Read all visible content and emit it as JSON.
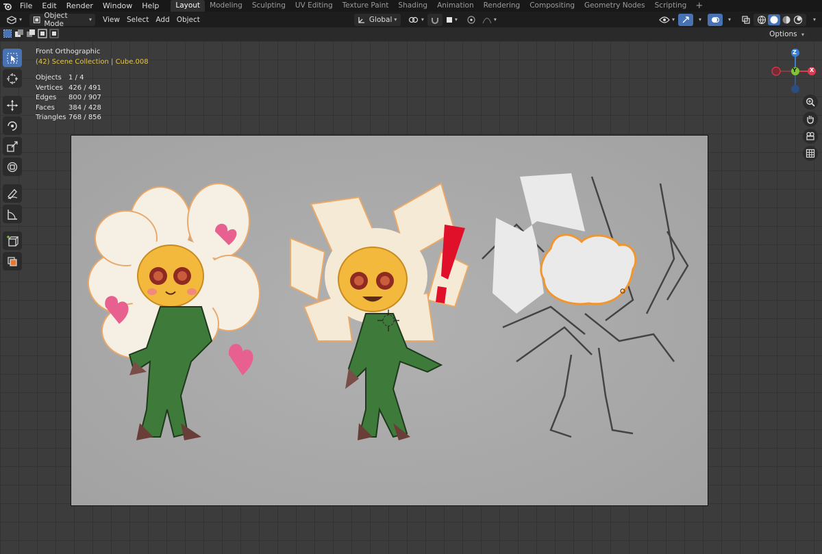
{
  "top_menu": {
    "items": [
      "File",
      "Edit",
      "Render",
      "Window",
      "Help"
    ],
    "workspace_tabs": [
      "Layout",
      "Modeling",
      "Sculpting",
      "UV Editing",
      "Texture Paint",
      "Shading",
      "Animation",
      "Rendering",
      "Compositing",
      "Geometry Nodes",
      "Scripting"
    ],
    "active_tab": "Layout",
    "add_tab": "+"
  },
  "header": {
    "mode": "Object Mode",
    "menus": [
      "View",
      "Select",
      "Add",
      "Object"
    ],
    "transform_orientation": "Global"
  },
  "options_label": "Options",
  "overlay": {
    "view_name": "Front Orthographic",
    "collection": "(42) Scene Collection | Cube.008"
  },
  "stats": [
    {
      "label": "Objects",
      "value": "1 / 4"
    },
    {
      "label": "Vertices",
      "value": "426 / 491"
    },
    {
      "label": "Edges",
      "value": "800 / 907"
    },
    {
      "label": "Faces",
      "value": "384 / 428"
    },
    {
      "label": "Triangles",
      "value": "768 / 856"
    }
  ],
  "gizmo": {
    "z": "Z",
    "y": "Y",
    "x": "X"
  },
  "colors": {
    "accent": "#4772b3",
    "collection_text": "#e6c84a",
    "axis_x": "#e03a4e",
    "axis_y": "#7fc432",
    "axis_z": "#3a7fd6",
    "selection": "#f1962e"
  },
  "tools": [
    "select-box-icon",
    "cursor-icon",
    "move-icon",
    "rotate-icon",
    "scale-icon",
    "transform-icon",
    "annotate-icon",
    "measure-icon",
    "add-cube-icon",
    "add-object-icon"
  ],
  "nav_buttons": [
    "zoom-icon",
    "hand-pan-icon",
    "camera-icon",
    "grid-perspective-icon"
  ]
}
